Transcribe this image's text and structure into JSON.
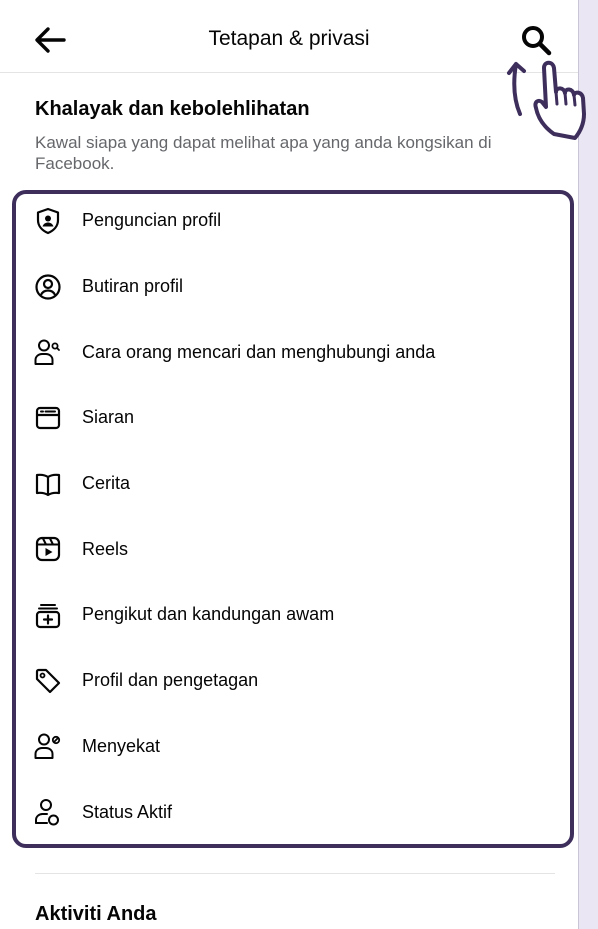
{
  "header": {
    "title": "Tetapan & privasi",
    "back_icon": "arrow-left-icon",
    "search_icon": "search-icon"
  },
  "section_audience": {
    "title": "Khalayak dan kebolehlihatan",
    "subtitle": "Kawal siapa yang dapat melihat apa yang anda kongsikan di Facebook."
  },
  "menu": {
    "items": [
      {
        "label": "Penguncian profil",
        "icon": "shield-user-icon"
      },
      {
        "label": "Butiran profil",
        "icon": "user-circle-icon"
      },
      {
        "label": "Cara orang mencari dan menghubungi anda",
        "icon": "user-search-icon"
      },
      {
        "label": "Siaran",
        "icon": "post-card-icon"
      },
      {
        "label": "Cerita",
        "icon": "book-icon"
      },
      {
        "label": "Reels",
        "icon": "reels-icon"
      },
      {
        "label": "Pengikut dan kandungan awam",
        "icon": "public-content-icon"
      },
      {
        "label": "Profil dan pengetagan",
        "icon": "tag-icon"
      },
      {
        "label": "Menyekat",
        "icon": "user-block-icon"
      },
      {
        "label": "Status Aktif",
        "icon": "user-active-icon"
      }
    ]
  },
  "section_activity": {
    "title": "Aktiviti Anda"
  },
  "colors": {
    "highlight": "#3d2e5c",
    "background": "#ebe6f4",
    "secondary_text": "#65676b"
  }
}
